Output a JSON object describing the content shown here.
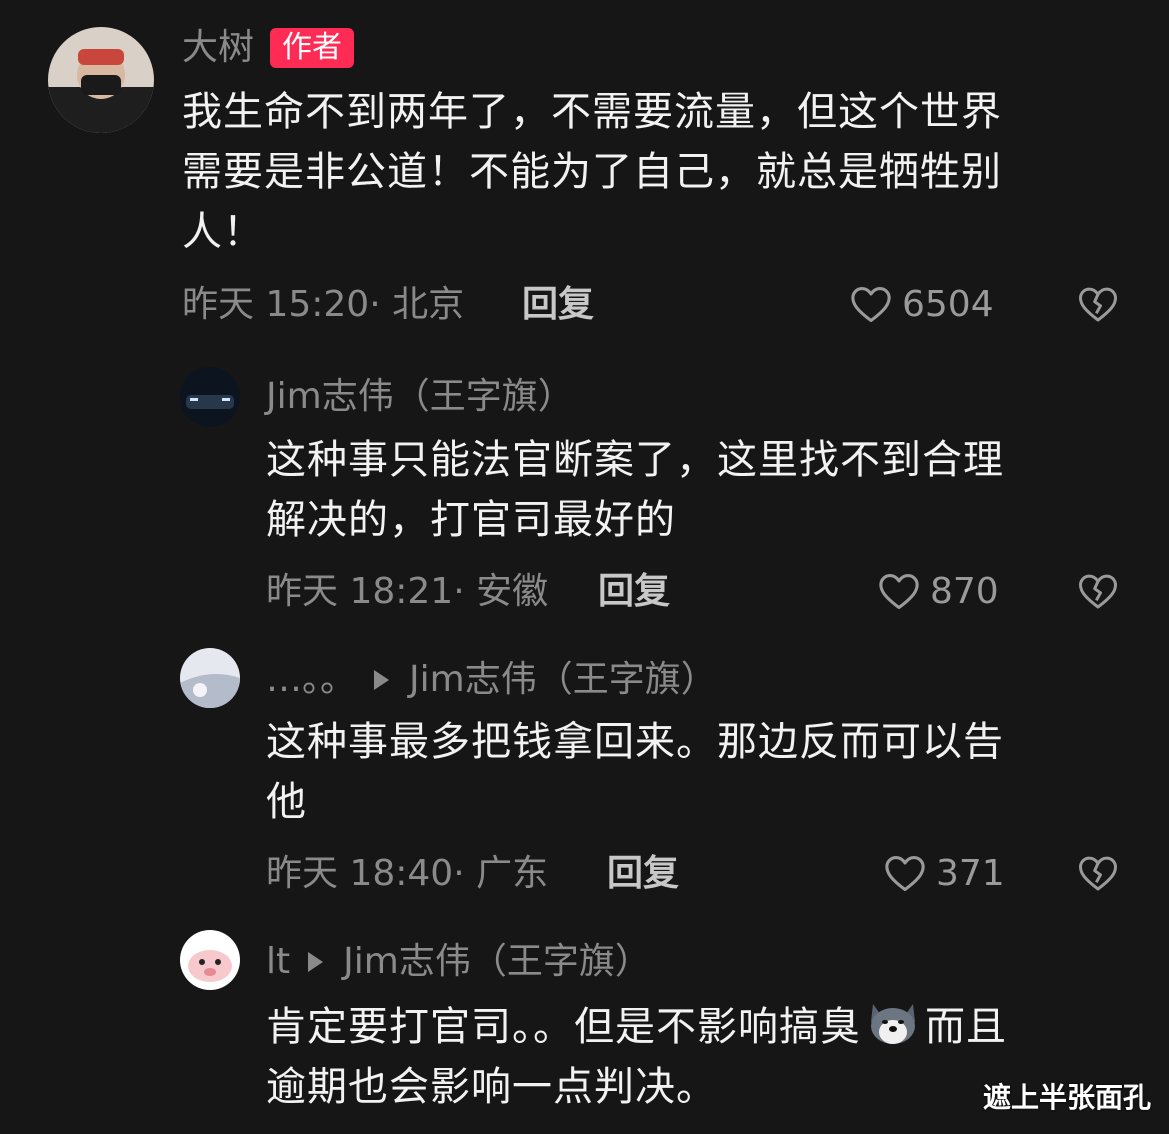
{
  "comments": [
    {
      "name": "大树",
      "badge": "作者",
      "lines": [
        "我生命不到两年了，不需要流量，但这个世界",
        "需要是非公道！不能为了自己，就总是牺牲别",
        "人！"
      ],
      "time": "昨天 15:20· 北京",
      "reply_label": "回复",
      "likes": "6504"
    },
    {
      "name": "Jim志伟（王字旗）",
      "lines": [
        "这种事只能法官断案了，这里找不到合理",
        "解决的，打官司最好的"
      ],
      "time": "昨天 18:21· 安徽",
      "reply_label": "回复",
      "likes": "870"
    },
    {
      "name": "…。。",
      "reply_to": "Jim志伟（王字旗）",
      "lines": [
        "这种事最多把钱拿回来。那边反而可以告",
        "他"
      ],
      "time": "昨天 18:40· 广东",
      "reply_label": "回复",
      "likes": "371"
    },
    {
      "name": "lt",
      "reply_to": "Jim志伟（王字旗）",
      "line1_before_emoji": "肯定要打官司。。但是不影响搞臭",
      "line1_after_emoji": "而且",
      "line2": "逾期也会影响一点判决。",
      "emoji_icon": "husky-dog-emoji"
    }
  ],
  "watermark": "遮上半张面孔",
  "colors": {
    "background": "#161616",
    "badge": "#fe2c55",
    "secondary_text": "#8a8a8a",
    "primary_text": "#f2f2f2"
  }
}
